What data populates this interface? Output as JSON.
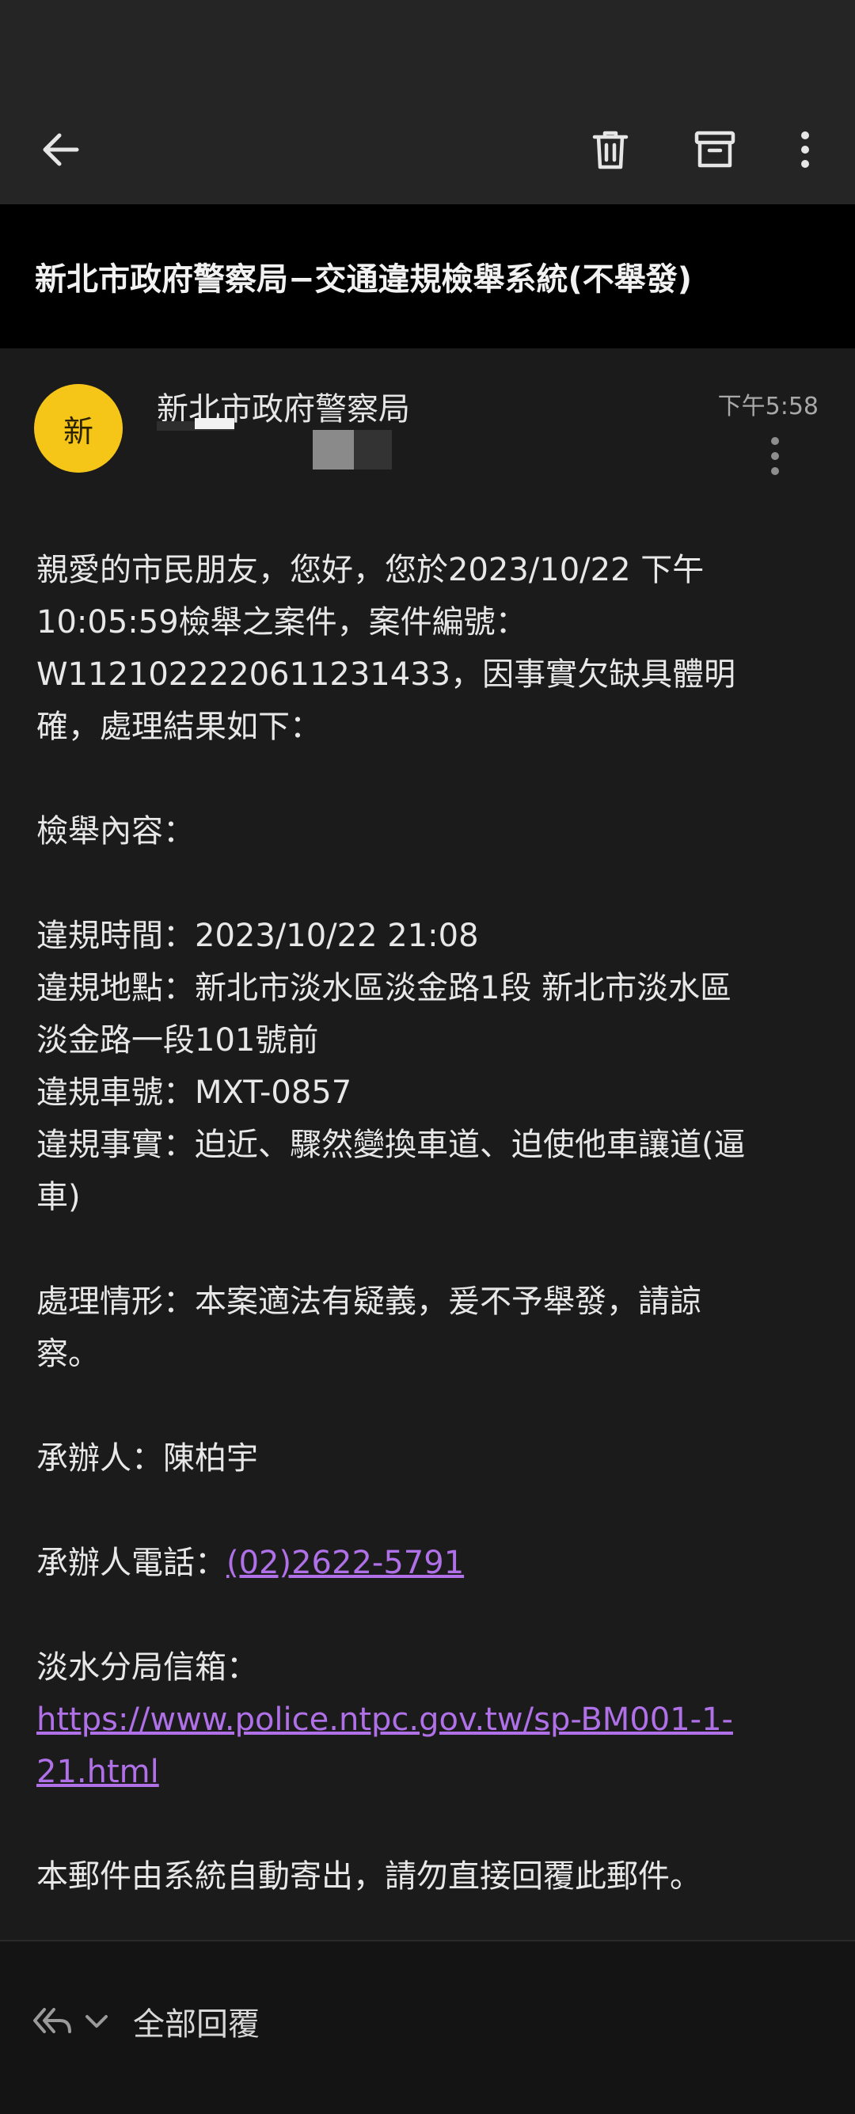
{
  "toolbar": {
    "back_icon": "arrow-left-icon",
    "delete_icon": "trash-icon",
    "archive_icon": "archive-icon",
    "more_icon": "more-vertical-icon"
  },
  "subject": "新北市政府警察局−交通違規檢舉系統(不舉發)",
  "message": {
    "avatar_letter": "新",
    "avatar_color": "#f5c518",
    "sender": "新北市政府警察局",
    "time": "下午5:58",
    "body": {
      "intro_1": "親愛的市民朋友，您好，您於2023/10/22 下午",
      "intro_2": "10:05:59檢舉之案件，案件編號：",
      "intro_3": "W1121022220611231433，因事實欠缺具體明",
      "intro_4": "確，處理結果如下：",
      "content_label": "檢舉內容：",
      "violation_time": "違規時間：2023/10/22 21:08",
      "location_1": "違規地點：新北市淡水區淡金路1段 新北市淡水區",
      "location_2": "淡金路一段101號前",
      "plate": "違規車號：MXT-0857",
      "fact_1": "違規事實：迫近、驟然變換車道、迫使他車讓道(逼",
      "fact_2": "車)",
      "result_1": "處理情形：本案適法有疑義，爰不予舉發，請諒",
      "result_2": "察。",
      "handler": "承辦人：陳柏宇",
      "phone_label": "承辦人電話：",
      "phone": "(02)2622-5791",
      "mailbox_label": "淡水分局信箱：",
      "url_1": "https://www.police.ntpc.gov.tw/sp-BM001-1-",
      "url_2": "21.html",
      "footer": "本郵件由系統自動寄出，請勿直接回覆此郵件。"
    }
  },
  "reply_bar": {
    "reply_icon": "reply-all-icon",
    "chevron_icon": "chevron-down-icon",
    "label": "全部回覆"
  },
  "colors": {
    "link": "#b070e8",
    "toolbar_bg": "#252525",
    "message_bg": "#1b1b1b"
  }
}
